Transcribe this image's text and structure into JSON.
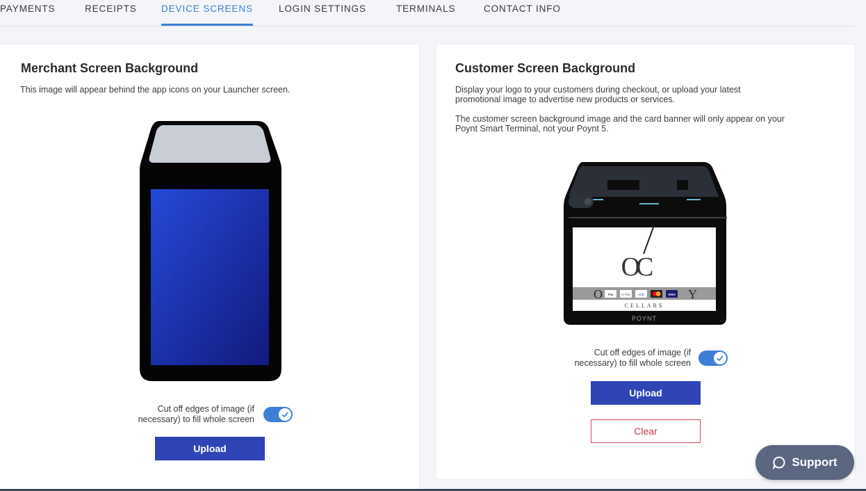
{
  "tabs": [
    {
      "label": "PAYMENTS"
    },
    {
      "label": "RECEIPTS"
    },
    {
      "label": "DEVICE SCREENS",
      "active": true
    },
    {
      "label": "LOGIN SETTINGS"
    },
    {
      "label": "TERMINALS"
    },
    {
      "label": "CONTACT INFO"
    }
  ],
  "merchant": {
    "title": "Merchant Screen Background",
    "description": "This image will appear behind the app icons on your Launcher screen.",
    "toggle_label_line1": "Cut off edges of image (if",
    "toggle_label_line2": "necessary) to fill whole screen",
    "toggle_on": true,
    "upload_label": "Upload"
  },
  "customer": {
    "title": "Customer Screen Background",
    "description1_line1": "Display your logo to your customers during checkout, or upload your latest",
    "description1_line2": "promotional image to advertise new products or services.",
    "description2_line1": "The customer screen background image and the card banner will only appear on your",
    "description2_line2": "Poynt Smart Terminal, not your Poynt 5.",
    "logo_letters": "OC",
    "logo_word_left": "O",
    "logo_word_right": "Y",
    "logo_subtitle": "CELLARS",
    "device_brand": "POYNT",
    "card_badges": [
      "Pay",
      "G Pay",
      "JCB",
      "MC",
      "VISA"
    ],
    "toggle_label_line1": "Cut off edges of image (if",
    "toggle_label_line2": "necessary) to fill whole screen",
    "toggle_on": true,
    "upload_label": "Upload",
    "clear_label": "Clear"
  },
  "support": {
    "label": "Support",
    "icon": "chat-bubble-icon"
  },
  "colors": {
    "accent": "#3e7fd6",
    "primary_button": "#2f45b5",
    "clear": "#c8384a",
    "support_bg": "#5b6680"
  }
}
